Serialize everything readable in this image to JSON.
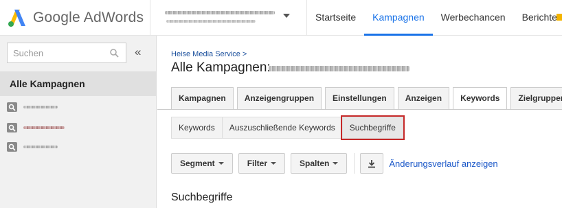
{
  "header": {
    "logo_text": "Google AdWords",
    "nav": [
      {
        "label": "Startseite",
        "active": false
      },
      {
        "label": "Kampagnen",
        "active": true
      },
      {
        "label": "Werbechancen",
        "active": false
      },
      {
        "label": "Berichte",
        "active": false
      }
    ]
  },
  "sidebar": {
    "search_placeholder": "Suchen",
    "collapse_label": "«",
    "heading": "Alle Kampagnen"
  },
  "main": {
    "breadcrumb": "Heise Media Service >",
    "title": "Alle Kampagnen:",
    "tabs": [
      {
        "label": "Kampagnen",
        "active": false
      },
      {
        "label": "Anzeigengruppen",
        "active": false
      },
      {
        "label": "Einstellungen",
        "active": false
      },
      {
        "label": "Anzeigen",
        "active": false
      },
      {
        "label": "Keywords",
        "active": true
      },
      {
        "label": "Zielgruppen",
        "active": false
      }
    ],
    "subtabs": [
      {
        "label": "Keywords",
        "active": false
      },
      {
        "label": "Auszuschließende Keywords",
        "active": false
      },
      {
        "label": "Suchbegriffe",
        "active": true
      }
    ],
    "toolbar": {
      "segment": "Segment",
      "filter": "Filter",
      "columns": "Spalten",
      "history_link": "Änderungsverlauf anzeigen"
    },
    "section_title": "Suchbegriffe"
  },
  "colors": {
    "accent": "#1a73e8",
    "link": "#1a57c8",
    "highlight_border": "#c62828"
  }
}
